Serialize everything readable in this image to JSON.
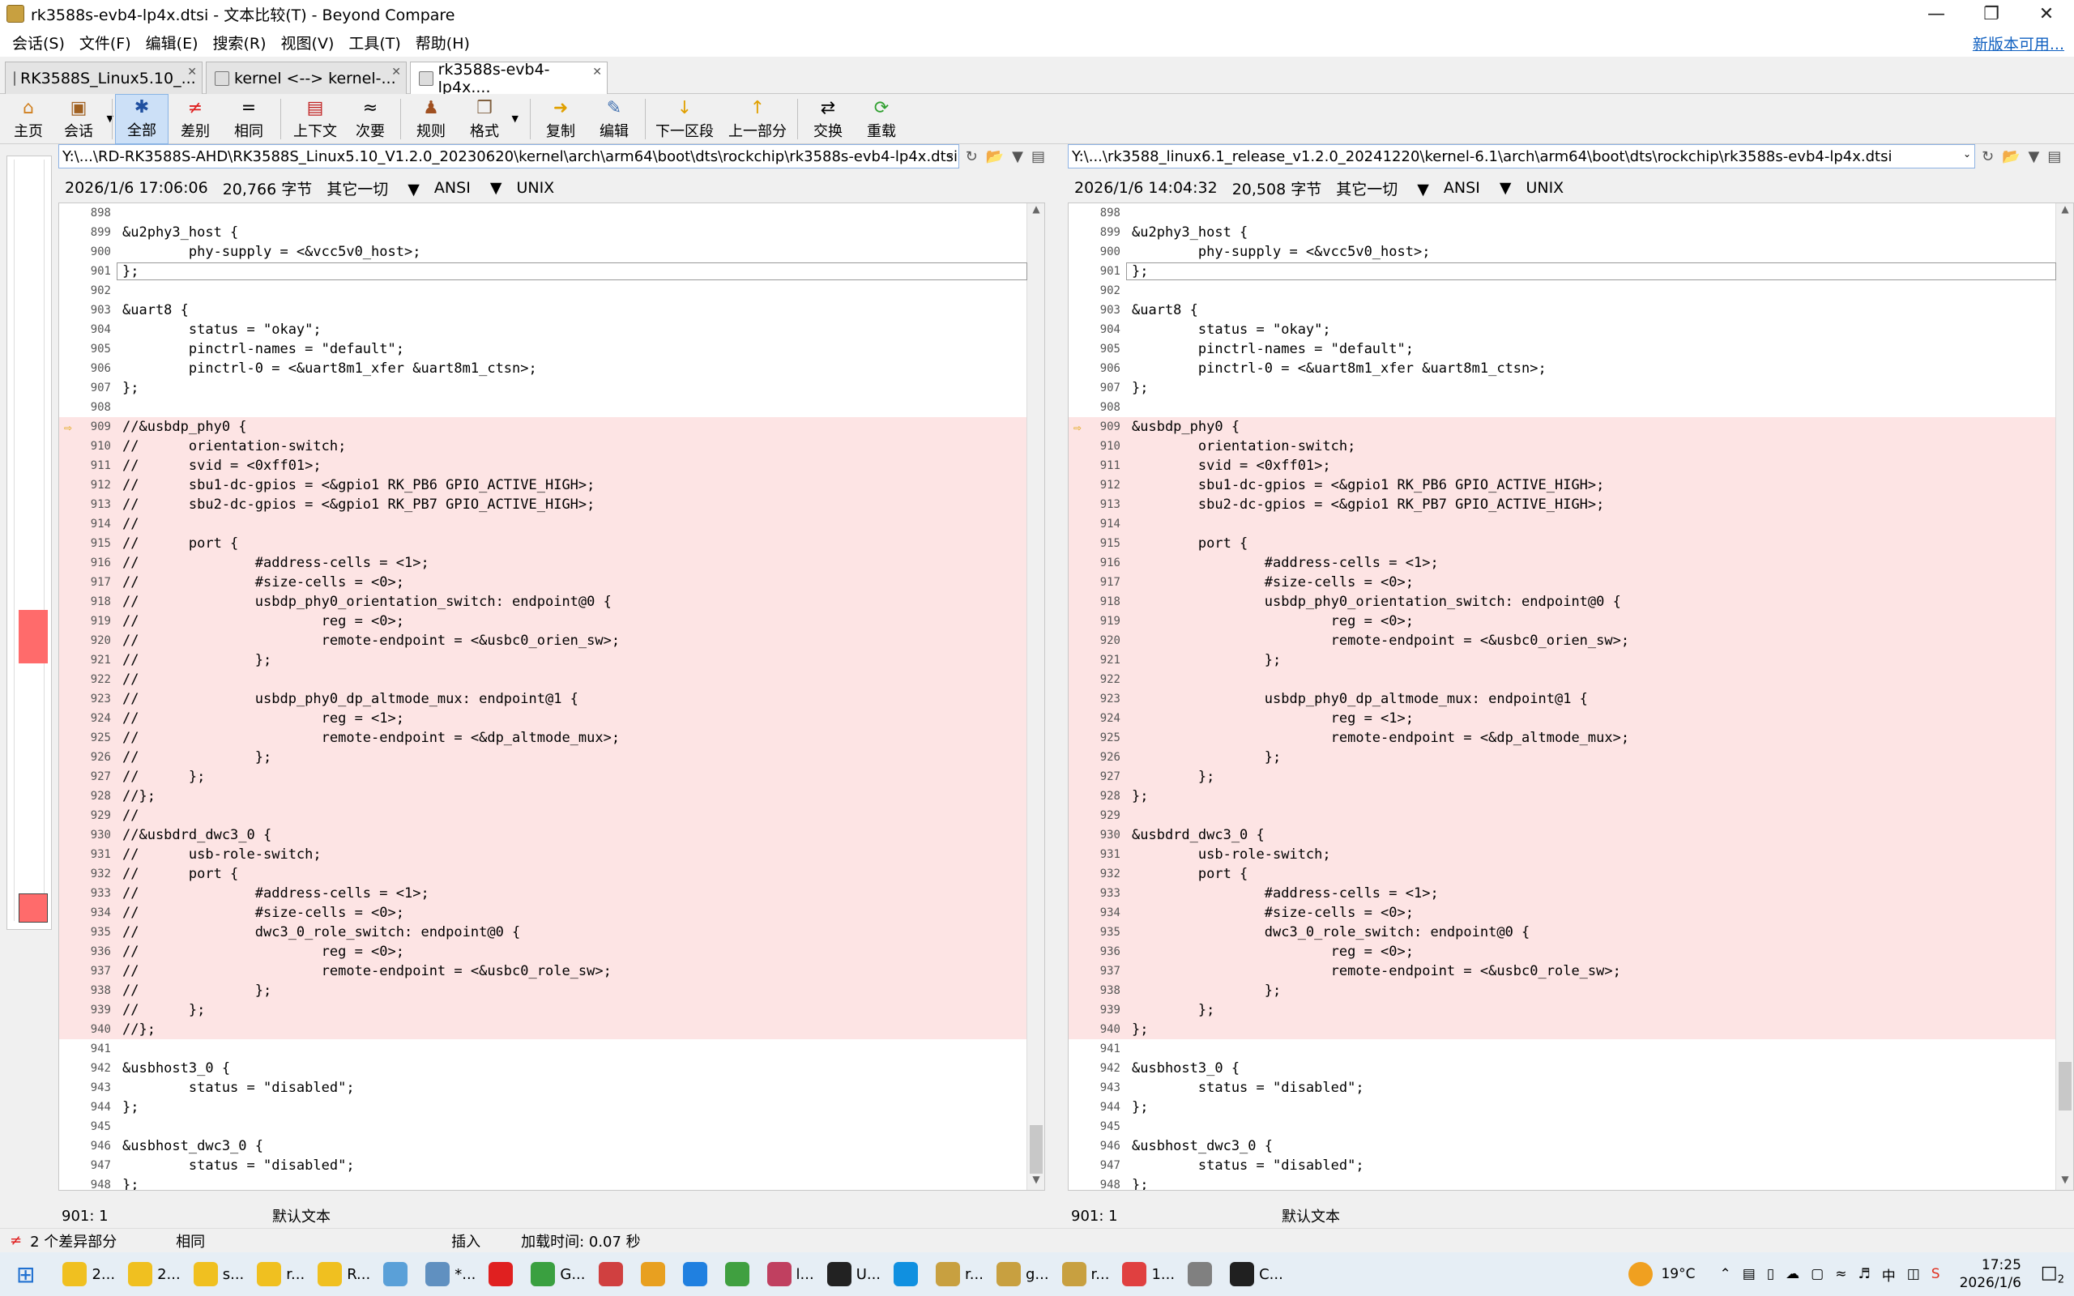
{
  "window": {
    "title": "rk3588s-evb4-lp4x.dtsi - 文本比较(T) - Beyond Compare"
  },
  "menu": {
    "items": [
      "会话(S)",
      "文件(F)",
      "编辑(E)",
      "搜索(R)",
      "视图(V)",
      "工具(T)",
      "帮助(H)"
    ],
    "update_link": "新版本可用..."
  },
  "tabs": [
    {
      "label": "RK3588S_Linux5.10_..."
    },
    {
      "label": "kernel <--> kernel-..."
    },
    {
      "label": "rk3588s-evb4-lp4x...."
    }
  ],
  "toolbar": {
    "home": "主页",
    "session": "会话",
    "all": "全部",
    "diffs": "差别",
    "same": "相同",
    "context": "上下文",
    "minor": "次要",
    "rules": "规则",
    "format": "格式",
    "copy": "复制",
    "edit": "编辑",
    "next_section": "下一区段",
    "prev_section": "上一部分",
    "swap": "交换",
    "reload": "重载"
  },
  "left": {
    "path": "Y:\\...\\RD-RK3588S-AHD\\RK3588S_Linux5.10_V1.2.0_20230620\\kernel\\arch\\arm64\\boot\\dts\\rockchip\\rk3588s-evb4-lp4x.dtsi",
    "date": "2026/1/6 17:06:06",
    "size": "20,766 字节",
    "filter": "其它一切",
    "encoding": "ANSI",
    "eol": "UNIX",
    "status_pos": "901: 1",
    "status_type": "默认文本",
    "lines": [
      {
        "n": "898",
        "t": ""
      },
      {
        "n": "899",
        "t": "&u2phy3_host {"
      },
      {
        "n": "900",
        "t": "        phy-supply = <&vcc5v0_host>;"
      },
      {
        "n": "901",
        "t": "};"
      },
      {
        "n": "902",
        "t": ""
      },
      {
        "n": "903",
        "t": "&uart8 {"
      },
      {
        "n": "904",
        "t": "        status = \"okay\";"
      },
      {
        "n": "905",
        "t": "        pinctrl-names = \"default\";"
      },
      {
        "n": "906",
        "t": "        pinctrl-0 = <&uart8m1_xfer &uart8m1_ctsn>;"
      },
      {
        "n": "907",
        "t": "};"
      },
      {
        "n": "908",
        "t": ""
      },
      {
        "n": "909",
        "t": "//&usbdp_phy0 {"
      },
      {
        "n": "910",
        "t": "//      orientation-switch;"
      },
      {
        "n": "911",
        "t": "//      svid = <0xff01>;"
      },
      {
        "n": "912",
        "t": "//      sbu1-dc-gpios = <&gpio1 RK_PB6 GPIO_ACTIVE_HIGH>;"
      },
      {
        "n": "913",
        "t": "//      sbu2-dc-gpios = <&gpio1 RK_PB7 GPIO_ACTIVE_HIGH>;"
      },
      {
        "n": "914",
        "t": "//"
      },
      {
        "n": "915",
        "t": "//      port {"
      },
      {
        "n": "916",
        "t": "//              #address-cells = <1>;"
      },
      {
        "n": "917",
        "t": "//              #size-cells = <0>;"
      },
      {
        "n": "918",
        "t": "//              usbdp_phy0_orientation_switch: endpoint@0 {"
      },
      {
        "n": "919",
        "t": "//                      reg = <0>;"
      },
      {
        "n": "920",
        "t": "//                      remote-endpoint = <&usbc0_orien_sw>;"
      },
      {
        "n": "921",
        "t": "//              };"
      },
      {
        "n": "922",
        "t": "//"
      },
      {
        "n": "923",
        "t": "//              usbdp_phy0_dp_altmode_mux: endpoint@1 {"
      },
      {
        "n": "924",
        "t": "//                      reg = <1>;"
      },
      {
        "n": "925",
        "t": "//                      remote-endpoint = <&dp_altmode_mux>;"
      },
      {
        "n": "926",
        "t": "//              };"
      },
      {
        "n": "927",
        "t": "//      };"
      },
      {
        "n": "928",
        "t": "//};"
      },
      {
        "n": "929",
        "t": "//"
      },
      {
        "n": "930",
        "t": "//&usbdrd_dwc3_0 {"
      },
      {
        "n": "931",
        "t": "//      usb-role-switch;"
      },
      {
        "n": "932",
        "t": "//      port {"
      },
      {
        "n": "933",
        "t": "//              #address-cells = <1>;"
      },
      {
        "n": "934",
        "t": "//              #size-cells = <0>;"
      },
      {
        "n": "935",
        "t": "//              dwc3_0_role_switch: endpoint@0 {"
      },
      {
        "n": "936",
        "t": "//                      reg = <0>;"
      },
      {
        "n": "937",
        "t": "//                      remote-endpoint = <&usbc0_role_sw>;"
      },
      {
        "n": "938",
        "t": "//              };"
      },
      {
        "n": "939",
        "t": "//      };"
      },
      {
        "n": "940",
        "t": "//};"
      },
      {
        "n": "941",
        "t": ""
      },
      {
        "n": "942",
        "t": "&usbhost3_0 {"
      },
      {
        "n": "943",
        "t": "        status = \"disabled\";"
      },
      {
        "n": "944",
        "t": "};"
      },
      {
        "n": "945",
        "t": ""
      },
      {
        "n": "946",
        "t": "&usbhost_dwc3_0 {"
      },
      {
        "n": "947",
        "t": "        status = \"disabled\";"
      },
      {
        "n": "948",
        "t": "};"
      }
    ]
  },
  "right": {
    "path": "Y:\\...\\rk3588_linux6.1_release_v1.2.0_20241220\\kernel-6.1\\arch\\arm64\\boot\\dts\\rockchip\\rk3588s-evb4-lp4x.dtsi",
    "date": "2026/1/6 14:04:32",
    "size": "20,508 字节",
    "filter": "其它一切",
    "encoding": "ANSI",
    "eol": "UNIX",
    "status_pos": "901: 1",
    "status_type": "默认文本",
    "lines": [
      {
        "n": "898",
        "t": ""
      },
      {
        "n": "899",
        "t": "&u2phy3_host {"
      },
      {
        "n": "900",
        "t": "        phy-supply = <&vcc5v0_host>;"
      },
      {
        "n": "901",
        "t": "};"
      },
      {
        "n": "902",
        "t": ""
      },
      {
        "n": "903",
        "t": "&uart8 {"
      },
      {
        "n": "904",
        "t": "        status = \"okay\";"
      },
      {
        "n": "905",
        "t": "        pinctrl-names = \"default\";"
      },
      {
        "n": "906",
        "t": "        pinctrl-0 = <&uart8m1_xfer &uart8m1_ctsn>;"
      },
      {
        "n": "907",
        "t": "};"
      },
      {
        "n": "908",
        "t": ""
      },
      {
        "n": "909",
        "t": "&usbdp_phy0 {"
      },
      {
        "n": "910",
        "t": "        orientation-switch;"
      },
      {
        "n": "911",
        "t": "        svid = <0xff01>;"
      },
      {
        "n": "912",
        "t": "        sbu1-dc-gpios = <&gpio1 RK_PB6 GPIO_ACTIVE_HIGH>;"
      },
      {
        "n": "913",
        "t": "        sbu2-dc-gpios = <&gpio1 RK_PB7 GPIO_ACTIVE_HIGH>;"
      },
      {
        "n": "914",
        "t": ""
      },
      {
        "n": "915",
        "t": "        port {"
      },
      {
        "n": "916",
        "t": "                #address-cells = <1>;"
      },
      {
        "n": "917",
        "t": "                #size-cells = <0>;"
      },
      {
        "n": "918",
        "t": "                usbdp_phy0_orientation_switch: endpoint@0 {"
      },
      {
        "n": "919",
        "t": "                        reg = <0>;"
      },
      {
        "n": "920",
        "t": "                        remote-endpoint = <&usbc0_orien_sw>;"
      },
      {
        "n": "921",
        "t": "                };"
      },
      {
        "n": "922",
        "t": ""
      },
      {
        "n": "923",
        "t": "                usbdp_phy0_dp_altmode_mux: endpoint@1 {"
      },
      {
        "n": "924",
        "t": "                        reg = <1>;"
      },
      {
        "n": "925",
        "t": "                        remote-endpoint = <&dp_altmode_mux>;"
      },
      {
        "n": "926",
        "t": "                };"
      },
      {
        "n": "927",
        "t": "        };"
      },
      {
        "n": "928",
        "t": "};"
      },
      {
        "n": "929",
        "t": ""
      },
      {
        "n": "930",
        "t": "&usbdrd_dwc3_0 {"
      },
      {
        "n": "931",
        "t": "        usb-role-switch;"
      },
      {
        "n": "932",
        "t": "        port {"
      },
      {
        "n": "933",
        "t": "                #address-cells = <1>;"
      },
      {
        "n": "934",
        "t": "                #size-cells = <0>;"
      },
      {
        "n": "935",
        "t": "                dwc3_0_role_switch: endpoint@0 {"
      },
      {
        "n": "936",
        "t": "                        reg = <0>;"
      },
      {
        "n": "937",
        "t": "                        remote-endpoint = <&usbc0_role_sw>;"
      },
      {
        "n": "938",
        "t": "                };"
      },
      {
        "n": "939",
        "t": "        };"
      },
      {
        "n": "940",
        "t": "};"
      },
      {
        "n": "941",
        "t": ""
      },
      {
        "n": "942",
        "t": "&usbhost3_0 {"
      },
      {
        "n": "943",
        "t": "        status = \"disabled\";"
      },
      {
        "n": "944",
        "t": "};"
      },
      {
        "n": "945",
        "t": ""
      },
      {
        "n": "946",
        "t": "&usbhost_dwc3_0 {"
      },
      {
        "n": "947",
        "t": "        status = \"disabled\";"
      },
      {
        "n": "948",
        "t": "};"
      }
    ]
  },
  "summary": {
    "diffs": "2 个差异部分",
    "same": "相同",
    "mode": "插入",
    "load_time": "加载时间: 0.07 秒"
  },
  "taskbar": {
    "apps": [
      {
        "label": "2...",
        "color": "#f0c020"
      },
      {
        "label": "2...",
        "color": "#f0c020"
      },
      {
        "label": "s...",
        "color": "#f0c020"
      },
      {
        "label": "r...",
        "color": "#f0c020"
      },
      {
        "label": "R...",
        "color": "#f0c020"
      },
      {
        "label": "",
        "color": "#5aa0d8"
      },
      {
        "label": "*...",
        "color": "#6090c0"
      },
      {
        "label": "",
        "color": "#e02020"
      },
      {
        "label": "G...",
        "color": "#3aa040"
      },
      {
        "label": "",
        "color": "#d04040"
      },
      {
        "label": "",
        "color": "#e8a020"
      },
      {
        "label": "",
        "color": "#2080e0"
      },
      {
        "label": "",
        "color": "#40a040"
      },
      {
        "label": "l...",
        "color": "#c04060"
      },
      {
        "label": "U...",
        "color": "#222222"
      },
      {
        "label": "",
        "color": "#1090e0"
      },
      {
        "label": "r...",
        "color": "#c8a040"
      },
      {
        "label": "g...",
        "color": "#c8a040"
      },
      {
        "label": "r...",
        "color": "#c8a040"
      },
      {
        "label": "1...",
        "color": "#e04040"
      },
      {
        "label": "",
        "color": "#808080"
      },
      {
        "label": "C...",
        "color": "#202020"
      }
    ],
    "weather": "19°C",
    "time": "17:25",
    "date": "2026/1/6",
    "notifications": "2"
  }
}
